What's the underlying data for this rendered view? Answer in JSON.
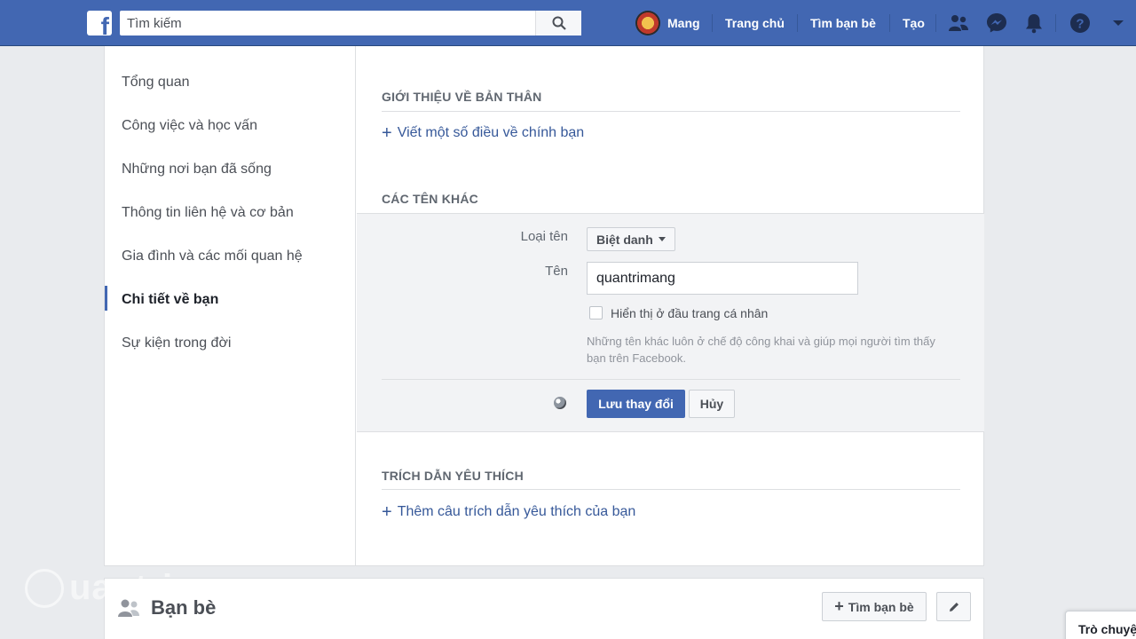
{
  "topbar": {
    "logo_letter": "f",
    "search_placeholder": "Tìm kiếm",
    "user_name": "Mang",
    "nav_home": "Trang chủ",
    "nav_find_friends": "Tìm bạn bè",
    "nav_create": "Tạo",
    "brand_color": "#4267b2"
  },
  "sidebar": {
    "items": [
      {
        "label": "Tổng quan"
      },
      {
        "label": "Công việc và học vấn"
      },
      {
        "label": "Những nơi bạn đã sống"
      },
      {
        "label": "Thông tin liên hệ và cơ bản"
      },
      {
        "label": "Gia đình và các mối quan hệ"
      },
      {
        "label": "Chi tiết về bạn",
        "active": true
      },
      {
        "label": "Sự kiện trong đời"
      }
    ]
  },
  "about": {
    "title": "GIỚI THIỆU VỀ BẢN THÂN",
    "add_link": "Viết một số điều về chính bạn"
  },
  "other_names": {
    "title": "CÁC TÊN KHÁC",
    "type_label": "Loại tên",
    "type_value": "Biệt danh",
    "name_label": "Tên",
    "name_value": "quantrimang",
    "show_on_profile_label": "Hiển thị ở đầu trang cá nhân",
    "help_text": "Những tên khác luôn ở chế độ công khai và giúp mọi người tìm thấy bạn trên Facebook.",
    "save_button": "Lưu thay đổi",
    "cancel_button": "Hủy"
  },
  "quotes": {
    "title": "TRÍCH DẪN YÊU THÍCH",
    "add_link": "Thêm câu trích dẫn yêu thích của bạn"
  },
  "friends": {
    "title": "Bạn bè",
    "find_friends_button": "Tìm bạn bè"
  },
  "chat": {
    "label": "Trò chuyện"
  },
  "watermark": {
    "text": "uantrimang"
  }
}
